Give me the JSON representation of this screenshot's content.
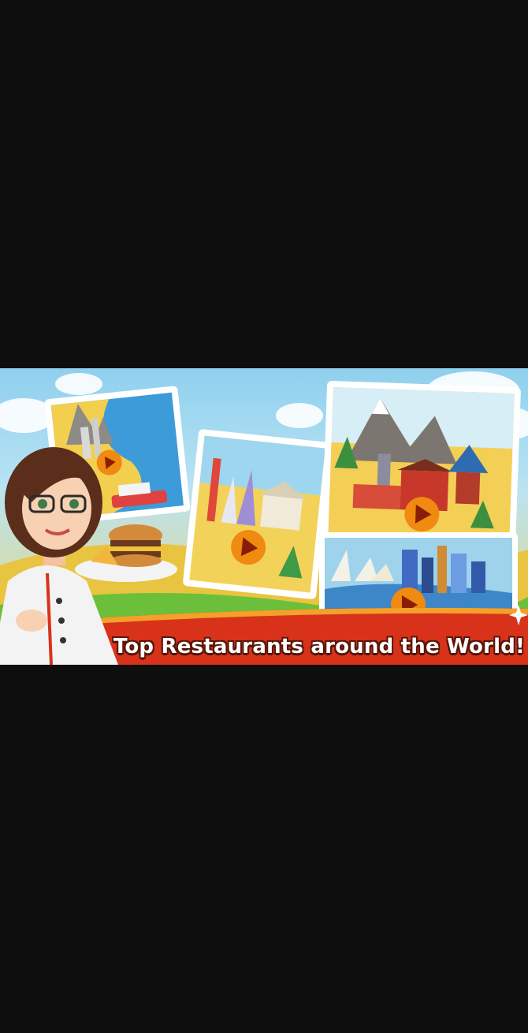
{
  "screen": {
    "background": "#0e0e0f"
  },
  "banner": {
    "tagline": "Top Restaurants around the World!",
    "ribbon_color": "#d8331a",
    "play_button_color": "#f08a10",
    "play_buttons": [
      "play-button-usa",
      "play-button-europe",
      "play-button-china",
      "play-button-australia"
    ]
  }
}
